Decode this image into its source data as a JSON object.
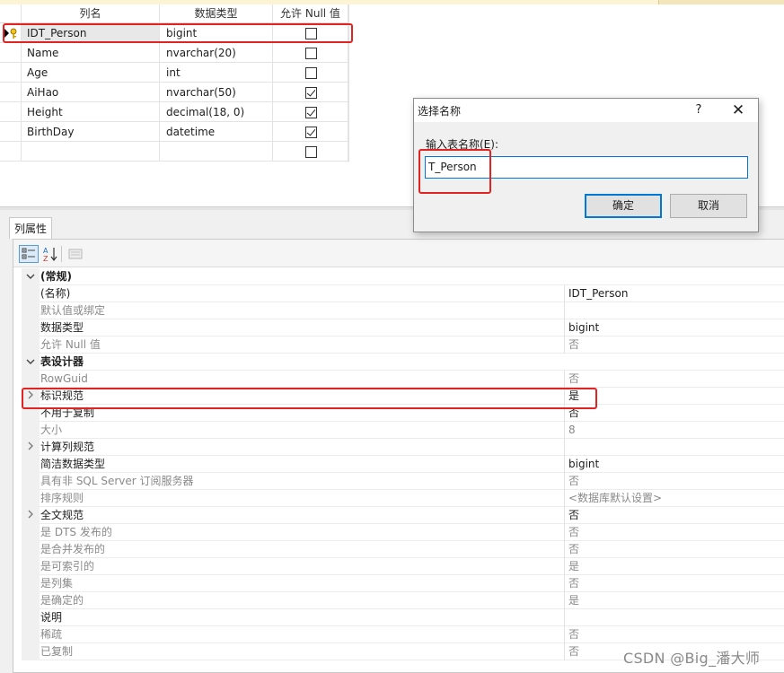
{
  "grid": {
    "headers": [
      "列名",
      "数据类型",
      "允许 Null 值"
    ],
    "rows": [
      {
        "name": "IDT_Person",
        "type": "bigint",
        "allow_null": false,
        "key": true
      },
      {
        "name": "Name",
        "type": "nvarchar(20)",
        "allow_null": false,
        "key": false
      },
      {
        "name": "Age",
        "type": "int",
        "allow_null": false,
        "key": false
      },
      {
        "name": "AiHao",
        "type": "nvarchar(50)",
        "allow_null": true,
        "key": false
      },
      {
        "name": "Height",
        "type": "decimal(18, 0)",
        "allow_null": true,
        "key": false
      },
      {
        "name": "BirthDay",
        "type": "datetime",
        "allow_null": true,
        "key": false
      },
      {
        "name": "",
        "type": "",
        "allow_null": false,
        "key": false
      }
    ]
  },
  "properties": {
    "tab_label": "列属性",
    "rows": [
      {
        "name": "(常规)",
        "value": "",
        "kind": "category",
        "expander": "v"
      },
      {
        "name": "(名称)",
        "value": "IDT_Person",
        "kind": "normal",
        "expander": ""
      },
      {
        "name": "默认值或绑定",
        "value": "",
        "kind": "dim",
        "expander": ""
      },
      {
        "name": "数据类型",
        "value": "bigint",
        "kind": "normal",
        "expander": ""
      },
      {
        "name": "允许 Null 值",
        "value": "否",
        "kind": "dim",
        "expander": ""
      },
      {
        "name": "表设计器",
        "value": "",
        "kind": "category",
        "expander": "v"
      },
      {
        "name": "RowGuid",
        "value": "否",
        "kind": "dim",
        "expander": ""
      },
      {
        "name": "标识规范",
        "value": "是",
        "kind": "normal",
        "expander": ">"
      },
      {
        "name": "不用于复制",
        "value": "否",
        "kind": "normal",
        "expander": ""
      },
      {
        "name": "大小",
        "value": "8",
        "kind": "dim",
        "expander": ""
      },
      {
        "name": "计算列规范",
        "value": "",
        "kind": "normal",
        "expander": ">"
      },
      {
        "name": "简洁数据类型",
        "value": "bigint",
        "kind": "normal",
        "expander": ""
      },
      {
        "name": "具有非 SQL Server 订阅服务器",
        "value": "否",
        "kind": "dim",
        "expander": ""
      },
      {
        "name": "排序规则",
        "value": "<数据库默认设置>",
        "kind": "dim",
        "expander": ""
      },
      {
        "name": "全文规范",
        "value": "否",
        "kind": "normal",
        "expander": ">"
      },
      {
        "name": "是 DTS 发布的",
        "value": "否",
        "kind": "dim",
        "expander": ""
      },
      {
        "name": "是合并发布的",
        "value": "否",
        "kind": "dim",
        "expander": ""
      },
      {
        "name": "是可索引的",
        "value": "是",
        "kind": "dim",
        "expander": ""
      },
      {
        "name": "是列集",
        "value": "否",
        "kind": "dim",
        "expander": ""
      },
      {
        "name": "是确定的",
        "value": "是",
        "kind": "dim",
        "expander": ""
      },
      {
        "name": "说明",
        "value": "",
        "kind": "normal",
        "expander": ""
      },
      {
        "name": "稀疏",
        "value": "否",
        "kind": "dim",
        "expander": ""
      },
      {
        "name": "已复制",
        "value": "否",
        "kind": "dim",
        "expander": ""
      }
    ]
  },
  "dialog": {
    "title": "选择名称",
    "help": "?",
    "close": "✕",
    "label": "输入表名称(E):",
    "input_value": "T_Person",
    "ok_label": "确定",
    "cancel_label": "取消"
  },
  "watermark": "CSDN @Big_潘大师",
  "colors": {
    "highlight": "#e32322",
    "accent": "#0078d7"
  }
}
